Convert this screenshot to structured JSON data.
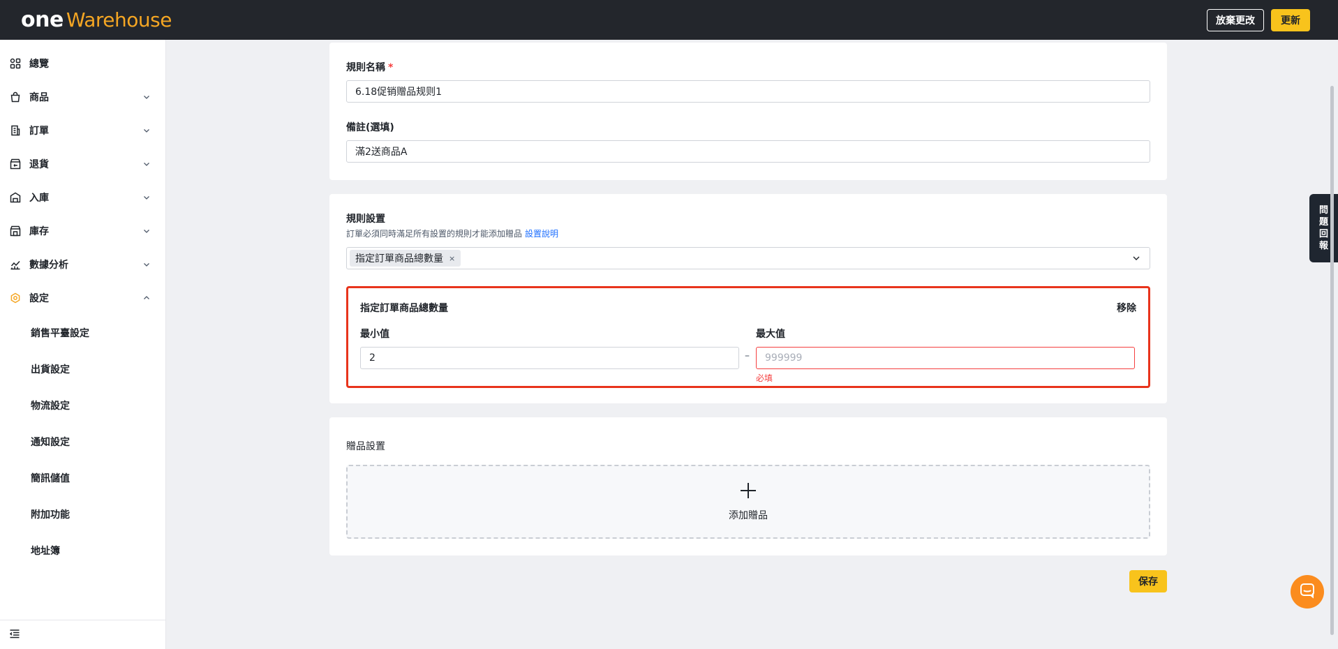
{
  "header": {
    "logo_one": "one",
    "logo_warehouse": "Warehouse",
    "discard_label": "放棄更改",
    "update_label": "更新"
  },
  "sidebar": {
    "items": [
      {
        "label": "總覽",
        "icon": "dashboard-icon"
      },
      {
        "label": "商品",
        "icon": "shopping-bag-icon"
      },
      {
        "label": "訂單",
        "icon": "receipt-icon"
      },
      {
        "label": "退貨",
        "icon": "return-box-icon"
      },
      {
        "label": "入庫",
        "icon": "inbound-icon"
      },
      {
        "label": "庫存",
        "icon": "inventory-icon"
      },
      {
        "label": "數據分析",
        "icon": "analytics-icon"
      },
      {
        "label": "設定",
        "icon": "settings-icon"
      }
    ],
    "sub_items": [
      "銷售平臺設定",
      "出貨設定",
      "物流設定",
      "通知設定",
      "簡訊儲值",
      "附加功能",
      "地址簿"
    ]
  },
  "basic": {
    "name_label": "規則名稱",
    "required_mark": "*",
    "name_value": "6.18促销赠品规则1",
    "note_label": "備註(選填)",
    "note_value": "滿2送商品A"
  },
  "rules": {
    "title": "規則設置",
    "hint": "訂單必須同時滿足所有設置的規則才能添加贈品",
    "help_link": "設置說明",
    "selected_tag": "指定訂單商品總數量",
    "tag_close": "×",
    "box_title": "指定訂單商品總數量",
    "remove_label": "移除",
    "min_label": "最小值",
    "max_label": "最大值",
    "min_value": "2",
    "separator": "–",
    "max_placeholder": "999999",
    "max_error": "必填"
  },
  "gifts": {
    "title": "贈品設置",
    "add_label": "添加贈品"
  },
  "save_label": "保存",
  "feedback_label": [
    "問",
    "題",
    "回",
    "報"
  ],
  "colors": {
    "brand_yellow": "#f8c31c",
    "header_bg": "#23262c",
    "error_red": "#e8341c",
    "link_blue": "#1e6fff",
    "chat_orange": "#fb8c1e"
  }
}
